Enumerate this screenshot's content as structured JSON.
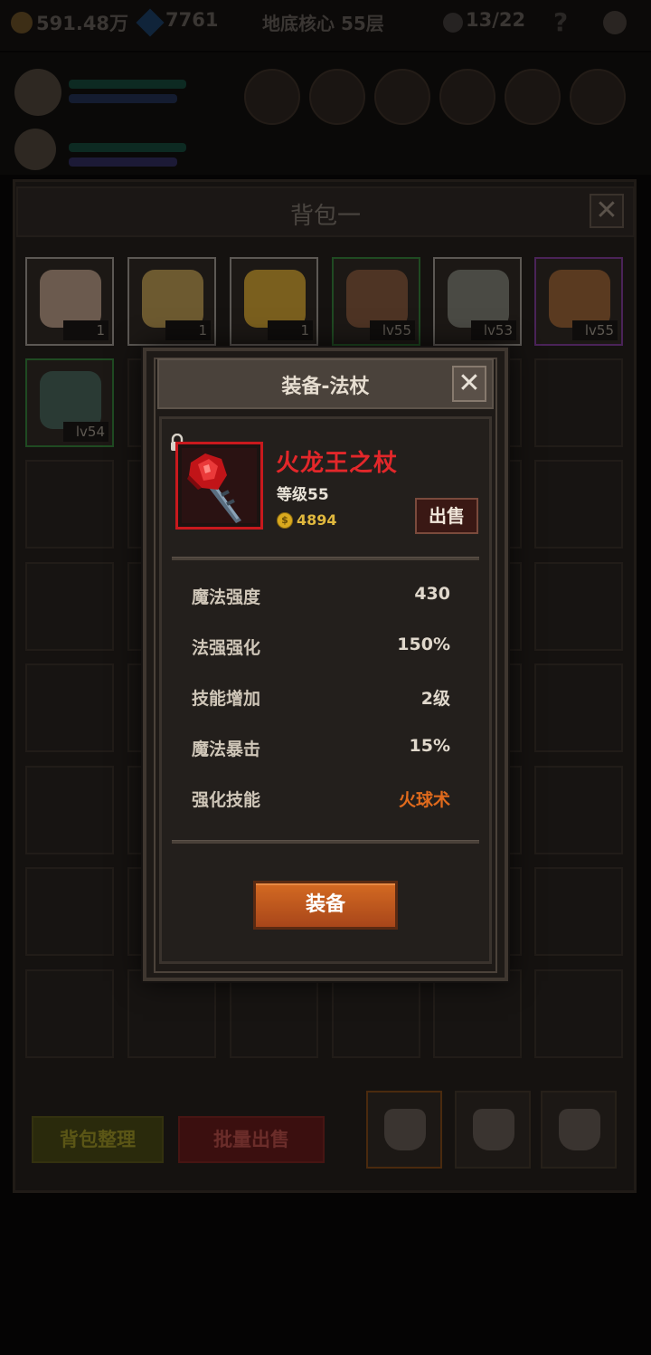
{
  "topbar": {
    "gold": "591.48万",
    "gems": "7761",
    "stage": "地底核心 55层",
    "kills": "13/22",
    "help": "?"
  },
  "bag": {
    "title": "背包一",
    "close_glyph": "✕",
    "items": [
      {
        "label": "1",
        "grade": "white",
        "icon": "cake-slice-icon",
        "color": "#6b5a4e"
      },
      {
        "label": "1",
        "grade": "white",
        "icon": "beer-mug-icon",
        "color": "#6d5a30"
      },
      {
        "label": "1",
        "grade": "white",
        "icon": "cheese-icon",
        "color": "#7a5f1e"
      },
      {
        "label": "lv55",
        "grade": "green",
        "icon": "ring-icon",
        "color": "#4e3424"
      },
      {
        "label": "lv53",
        "grade": "white",
        "icon": "shoulder-armor-icon",
        "color": "#4a4a44"
      },
      {
        "label": "lv55",
        "grade": "purple",
        "icon": "dice-box-icon",
        "color": "#5a3a20"
      },
      {
        "label": "lv54",
        "grade": "green",
        "icon": "dagger-icon",
        "color": "#2a3a34"
      }
    ],
    "arrange_label": "背包整理",
    "bulk_sell_label": "批量出售"
  },
  "modal": {
    "title": "装备-法杖",
    "close_glyph": "✕",
    "item_name": "火龙王之杖",
    "item_level": "等级55",
    "gold_symbol": "$",
    "price": "4894",
    "sell_label": "出售",
    "stats": [
      {
        "label": "魔法强度",
        "value": "430"
      },
      {
        "label": "法强强化",
        "value": "150%"
      },
      {
        "label": "技能增加",
        "value": "2级"
      },
      {
        "label": "魔法暴击",
        "value": "15%"
      },
      {
        "label": "强化技能",
        "value": "火球术"
      }
    ],
    "equip_label": "装备",
    "colors": {
      "name": "#e3272a",
      "frame": "#c8191d",
      "skill_value": "#e06a1c",
      "equip_button": "#c65e20"
    }
  }
}
